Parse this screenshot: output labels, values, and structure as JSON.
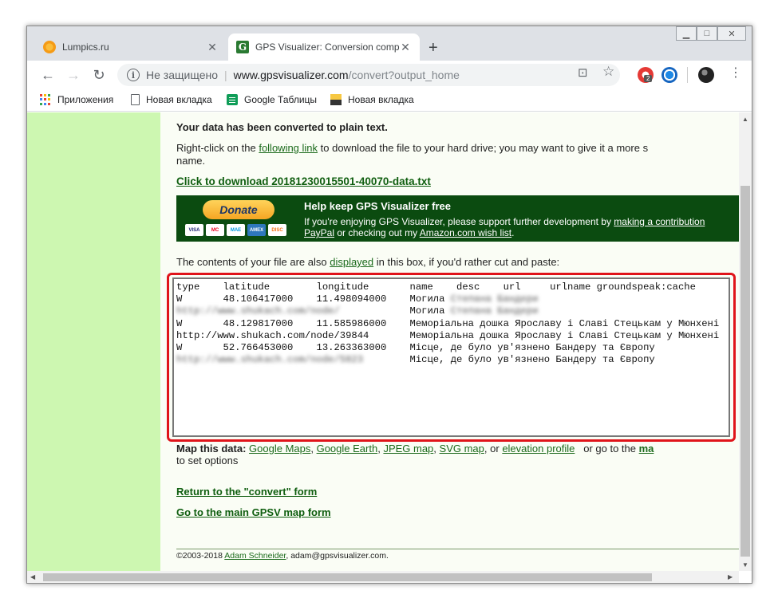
{
  "browser": {
    "tabs": [
      {
        "title": "Lumpics.ru",
        "active": false,
        "icon": "orange-circle-icon"
      },
      {
        "title": "GPS Visualizer: Conversion comp",
        "active": true,
        "icon": "gpsv-icon"
      }
    ],
    "favicon_letter": "G",
    "new_tab": "+",
    "address": {
      "security_label": "Не защищено",
      "host": "www.gpsvisualizer.com",
      "path": "/convert?output_home"
    },
    "bookmarks": [
      {
        "label": "Приложения",
        "icon": "apps-grid-icon"
      },
      {
        "label": "Новая вкладка",
        "icon": "page-icon"
      },
      {
        "label": "Google Таблицы",
        "icon": "sheets-icon"
      },
      {
        "label": "Новая вкладка",
        "icon": "image-icon"
      }
    ],
    "extension_badge": "2"
  },
  "page": {
    "heading": "Your data has been converted to plain text.",
    "intro_before": "Right-click on the ",
    "intro_link": "following link",
    "intro_after": " to download the file to your hard drive; you may want to give it a more s",
    "intro_line2": "name.",
    "download_link": "Click to download 20181230015501-40070-data.txt",
    "donate": {
      "button": "Donate",
      "cards": [
        "VISA",
        "MC",
        "MAE",
        "AMEX",
        "DISC"
      ],
      "title": "Help keep GPS Visualizer free",
      "text_before": "If you're enjoying GPS Visualizer, please support further development by ",
      "link1": "making a contribution",
      "link_paypal": "PayPal",
      "text_mid": " or checking out my ",
      "link2": "Amazon.com wish list",
      "text_end": "."
    },
    "contents_before": "The contents of your file are also ",
    "contents_link": "displayed",
    "contents_after": " in this box, if you'd rather cut and paste:",
    "textbox_lines": [
      {
        "text": "type    latitude        longitude       name    desc    url     urlname groundspeak:cache",
        "blur": ""
      },
      {
        "text": "W       48.106417000    11.498094000    Могила",
        "blur": " Степана Бандери"
      },
      {
        "text": "                                        Могила",
        "blur": " Степана Бандери"
      },
      {
        "text": "W       48.129817000    11.585986000    Меморіальна дошка Ярославу і Славі Стецькам у Мюнхені",
        "blur": ""
      },
      {
        "text": "http://www.shukach.com/node/39844       Меморіальна дошка Ярославу і Славі Стецькам у Мюнхені",
        "blur": ""
      },
      {
        "text": "W       52.766453000    13.263363000    Місце, де було ув'язнено Бандеру та Європу",
        "blur": ""
      },
      {
        "text": "                                        Місце, де було ув'язнено Бандеру та Європу",
        "blur": ""
      }
    ],
    "blurred_prefix_1": "http://www.shukach.com/node/",
    "blurred_prefix_2": "http://www.shukach.com/node/5823",
    "map_label": "Map this data:",
    "map_links": [
      "Google Maps",
      "Google Earth",
      "JPEG map",
      "SVG map",
      "elevation profile"
    ],
    "map_or": "or",
    "map_goto": "or go to the",
    "map_goto_link": "ma",
    "map_line2": "to set options",
    "return_link": "Return to the \"convert\" form",
    "main_link": "Go to the main GPSV map form",
    "footer_copy": "©2003-2018 ",
    "footer_author": "Adam Schneider",
    "footer_email": ", adam@gpsvisualizer.com."
  }
}
